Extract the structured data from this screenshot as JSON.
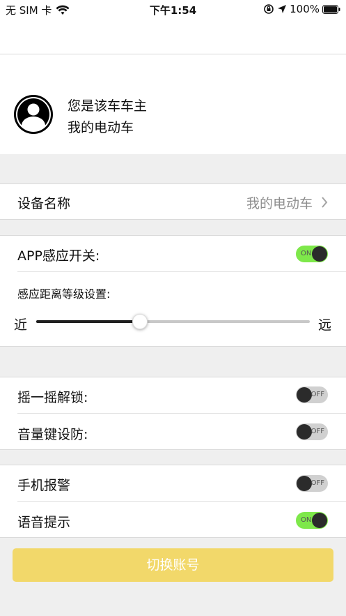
{
  "status_bar": {
    "carrier": "无 SIM 卡",
    "time": "下午1:54",
    "battery": "100%"
  },
  "profile": {
    "owner_text": "您是该车车主",
    "car_name": "我的电动车"
  },
  "device_name": {
    "label": "设备名称",
    "value": "我的电动车"
  },
  "app_sensor": {
    "label": "APP感应开关:",
    "enabled": true,
    "toggle_text": "ON"
  },
  "distance": {
    "label": "感应距离等级设置:",
    "min_label": "近",
    "max_label": "远",
    "level_fraction": 0.38
  },
  "shake_unlock": {
    "label": "摇一摇解锁:",
    "enabled": false,
    "toggle_text": "OFF"
  },
  "volume_arm": {
    "label": "音量键设防:",
    "enabled": false,
    "toggle_text": "OFF"
  },
  "phone_alarm": {
    "label": "手机报警",
    "enabled": false,
    "toggle_text": "OFF"
  },
  "voice_prompt": {
    "label": "语音提示",
    "enabled": true,
    "toggle_text": "ON"
  },
  "switch_account": {
    "label": "切换账号"
  },
  "colors": {
    "toggle_on": "#7ee84a",
    "button": "#f2d86a"
  }
}
